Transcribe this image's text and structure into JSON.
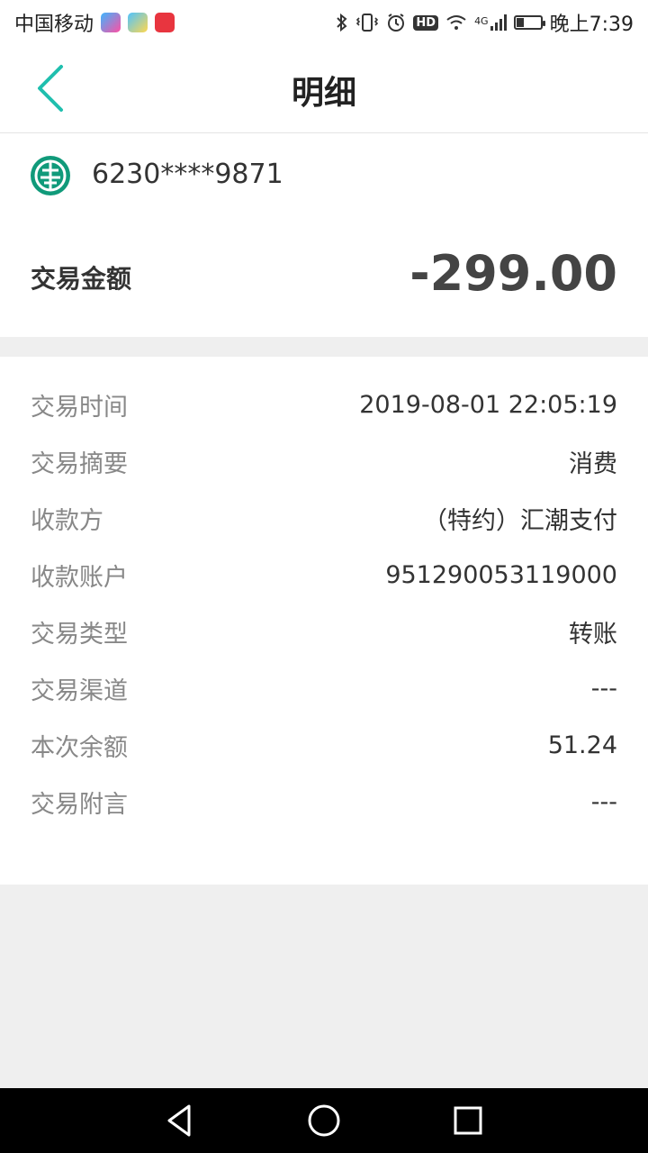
{
  "status_bar": {
    "carrier": "中国移动",
    "network": "4G",
    "time": "晚上7:39",
    "icons": [
      "youku-app-icon",
      "paper-plane-app-icon",
      "toutiao-app-icon",
      "bluetooth-icon",
      "vibrate-icon",
      "alarm-icon",
      "hd-icon",
      "wifi-icon",
      "signal-icon",
      "battery-icon"
    ],
    "hd_label": "HD"
  },
  "header": {
    "title": "明细",
    "accent_color": "#1fbfae"
  },
  "card": {
    "account_number": "6230****9871",
    "amount_label": "交易金额",
    "amount_value": "-299.00"
  },
  "details": {
    "rows": [
      {
        "label": "交易时间",
        "value": "2019-08-01 22:05:19"
      },
      {
        "label": "交易摘要",
        "value": "消费"
      },
      {
        "label": "收款方",
        "value": "（特约）汇潮支付"
      },
      {
        "label": "收款账户",
        "value": "951290053119000"
      },
      {
        "label": "交易类型",
        "value": "转账"
      },
      {
        "label": "交易渠道",
        "value": "---"
      },
      {
        "label": "本次余额",
        "value": "51.24"
      },
      {
        "label": "交易附言",
        "value": "---"
      }
    ]
  },
  "nav_bar": {
    "buttons": [
      "back-triangle-icon",
      "home-circle-icon",
      "recents-square-icon"
    ]
  }
}
